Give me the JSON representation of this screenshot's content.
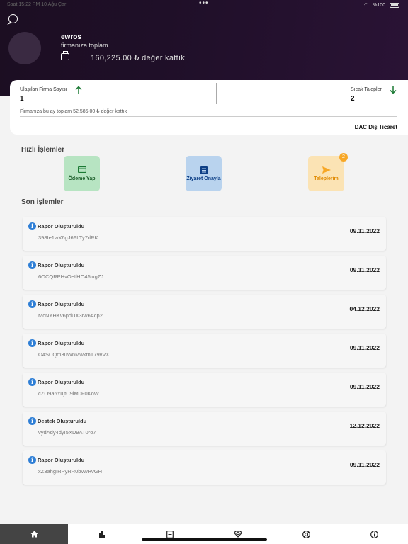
{
  "status": {
    "left": "Saat 15:22 PM 10 Ağu Çar",
    "battery": "%100"
  },
  "profile": {
    "name": "ewros",
    "subtitle": "firmanıza toplam",
    "total_value": "160,225.00 ₺ değer kattık"
  },
  "stats": {
    "reached_label": "Ulaşılan Firma Sayısı",
    "reached_value": "1",
    "hot_label": "Sıcak Talepler",
    "hot_value": "2",
    "month_note": "Firmanıza bu ay toplam 52,585.00 ₺ değer kattık",
    "firm_name": "DAC Dış Ticaret"
  },
  "quick_actions": {
    "title": "Hızlı İşlemler",
    "pay_label": "Ödeme Yap",
    "visit_label": "Ziyaret Onayla",
    "requests_label": "Taleplerim",
    "requests_badge": "2"
  },
  "recent": {
    "title": "Son işlemler",
    "items": [
      {
        "title": "Rapor Oluşturuldu",
        "code": "398Ie1wX6gJ6FLTy7dRK",
        "date": "09.11.2022"
      },
      {
        "title": "Rapor Oluşturuldu",
        "code": "6OCQRPHvOHfHO45lugZJ",
        "date": "09.11.2022"
      },
      {
        "title": "Rapor Oluşturuldu",
        "code": "McNYHKv6pdUX3rw6Acp2",
        "date": "04.12.2022"
      },
      {
        "title": "Rapor Oluşturuldu",
        "code": "O4SCQm3uWnMwkmT79vVX",
        "date": "09.11.2022"
      },
      {
        "title": "Rapor Oluşturuldu",
        "code": "cZO9a6YujtC9lM0F0KoW",
        "date": "09.11.2022"
      },
      {
        "title": "Destek Oluşturuldu",
        "code": "vydAdy4dyI5XD9AT0ro7",
        "date": "12.12.2022"
      },
      {
        "title": "Rapor Oluşturuldu",
        "code": "xZ3ahgIRPyRR0bvwHvGH",
        "date": "09.11.2022"
      }
    ]
  },
  "tabs": [
    "home-icon",
    "bar-chart-icon",
    "document-icon",
    "handshake-icon",
    "support-icon",
    "info-icon"
  ],
  "colors": {
    "header_bg": "#1f0f28",
    "accent_green": "#1b7a34",
    "accent_blue": "#0d3f86",
    "accent_orange": "#f7a726",
    "info_blue": "#2f7fd6"
  }
}
